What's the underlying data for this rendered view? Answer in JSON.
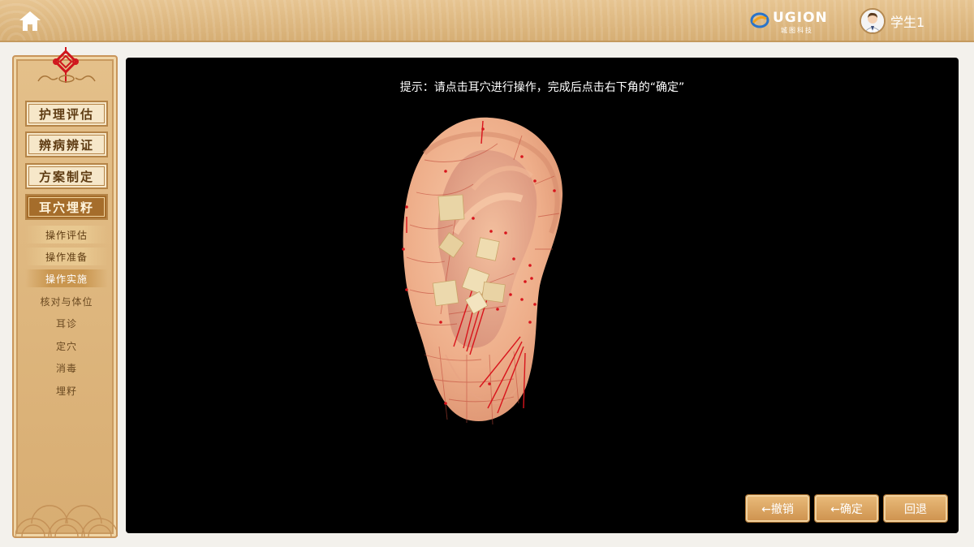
{
  "header": {
    "brand": {
      "name": "UGION",
      "subtitle": "城图科技"
    },
    "user": {
      "name": "学生1"
    }
  },
  "sidebar": {
    "main_items": [
      {
        "label": "护理评估"
      },
      {
        "label": "辨病辨证"
      },
      {
        "label": "方案制定"
      },
      {
        "label": "耳穴埋籽"
      }
    ],
    "groups": [
      {
        "label": "操作评估"
      },
      {
        "label": "操作准备"
      },
      {
        "label": "操作实施"
      }
    ],
    "steps": [
      {
        "label": "核对与体位"
      },
      {
        "label": "耳诊"
      },
      {
        "label": "定穴"
      },
      {
        "label": "消毒"
      },
      {
        "label": "埋籽"
      }
    ],
    "active_main": "耳穴埋籽",
    "active_group": "操作实施"
  },
  "stage": {
    "hint": "提示：请点击耳穴进行操作，完成后点击右下角的“确定”"
  },
  "actions": {
    "undo_label": "←撤销",
    "confirm_label": "←确定",
    "back_label": "回退"
  },
  "colors": {
    "accent": "#a56d2b",
    "panel": "#000000",
    "acupoint": "#d8141c"
  },
  "icons": {
    "home": "home-icon",
    "logo": "ugion-logo-icon",
    "avatar": "avatar-icon",
    "knot": "chinese-knot-icon"
  }
}
